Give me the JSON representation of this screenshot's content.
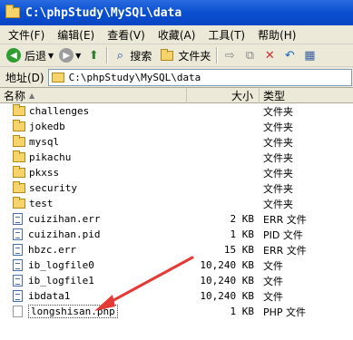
{
  "window": {
    "title": "C:\\phpStudy\\MySQL\\data"
  },
  "menu": [
    "文件(F)",
    "编辑(E)",
    "查看(V)",
    "收藏(A)",
    "工具(T)",
    "帮助(H)"
  ],
  "toolbar": {
    "back_label": "后退",
    "search_label": "搜索",
    "folders_label": "文件夹"
  },
  "address": {
    "label": "地址(D)",
    "path": "C:\\phpStudy\\MySQL\\data"
  },
  "columns": {
    "name": "名称",
    "size": "大小",
    "type": "类型"
  },
  "files": [
    {
      "name": "challenges",
      "size": "",
      "type": "文件夹",
      "icon": "folder-icon"
    },
    {
      "name": "jokedb",
      "size": "",
      "type": "文件夹",
      "icon": "folder-icon"
    },
    {
      "name": "mysql",
      "size": "",
      "type": "文件夹",
      "icon": "folder-icon"
    },
    {
      "name": "pikachu",
      "size": "",
      "type": "文件夹",
      "icon": "folder-icon"
    },
    {
      "name": "pkxss",
      "size": "",
      "type": "文件夹",
      "icon": "folder-icon"
    },
    {
      "name": "security",
      "size": "",
      "type": "文件夹",
      "icon": "folder-icon"
    },
    {
      "name": "test",
      "size": "",
      "type": "文件夹",
      "icon": "folder-icon"
    },
    {
      "name": "cuizihan.err",
      "size": "2 KB",
      "type": "ERR 文件",
      "icon": "file-icon"
    },
    {
      "name": "cuizihan.pid",
      "size": "1 KB",
      "type": "PID 文件",
      "icon": "file-icon"
    },
    {
      "name": "hbzc.err",
      "size": "15 KB",
      "type": "ERR 文件",
      "icon": "file-icon"
    },
    {
      "name": "ib_logfile0",
      "size": "10,240 KB",
      "type": "文件",
      "icon": "file-icon"
    },
    {
      "name": "ib_logfile1",
      "size": "10,240 KB",
      "type": "文件",
      "icon": "file-icon"
    },
    {
      "name": "ibdata1",
      "size": "10,240 KB",
      "type": "文件",
      "icon": "file-icon"
    },
    {
      "name": "longshisan.php",
      "size": "1 KB",
      "type": "PHP 文件",
      "icon": "php-file-icon"
    }
  ],
  "annotation": {
    "color": "#e53935",
    "icon": "red-arrow-annotation"
  }
}
